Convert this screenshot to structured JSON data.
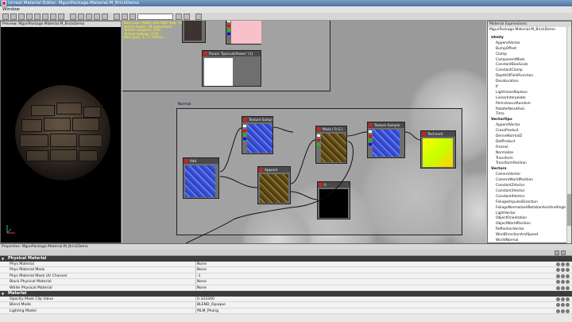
{
  "window": {
    "title": "Unreal Material Editor: MgunPackage.Material.M_BrickDemo"
  },
  "menubar": {
    "items": [
      "Window"
    ]
  },
  "toolbar": {
    "search_placeholder": ""
  },
  "preview": {
    "title": "Preview: MgunPackage.Material.M_BrickDemo"
  },
  "canvas": {
    "info_lines": [
      "Base pass shader with light map: 73 instructions",
      "Vertex shader: 28 instructions",
      "Texture samplers: 2/16",
      "Texture lookups: 2/16",
      "Base pass: 1 / 11 instruc..."
    ],
    "group_label": "Normal",
    "nodes": {
      "specular_power": "Param 'SpecularPower' (1)",
      "texture_sample_1": "Texture Sample",
      "mask": "Mask ( R G )",
      "texture_sample_2": "Texture Sample",
      "tex_coord": "TexCoord",
      "add": "Add",
      "append": "Append",
      "constant": "0"
    }
  },
  "expressions": {
    "title": "Material Expressions: MgunPackage.Material.M_BrickDemo",
    "items": [
      {
        "type": "cat",
        "label": "Utility"
      },
      {
        "type": "item",
        "label": "AppendVector"
      },
      {
        "type": "item",
        "label": "BumpOffset"
      },
      {
        "type": "item",
        "label": "Clamp"
      },
      {
        "type": "item",
        "label": "ComponentMask"
      },
      {
        "type": "item",
        "label": "ConstantBiasScale"
      },
      {
        "type": "item",
        "label": "ConstantClamp"
      },
      {
        "type": "item",
        "label": "DepthOfFieldFunction"
      },
      {
        "type": "item",
        "label": "Desaturation"
      },
      {
        "type": "item",
        "label": "If"
      },
      {
        "type": "item",
        "label": "LightmassReplace"
      },
      {
        "type": "item",
        "label": "LinearInterpolate"
      },
      {
        "type": "item",
        "label": "PerInstanceRandom"
      },
      {
        "type": "item",
        "label": "RotateAboutAxis"
      },
      {
        "type": "item",
        "label": "Time"
      },
      {
        "type": "cat",
        "label": "VectorOps"
      },
      {
        "type": "item",
        "label": "AppendVector"
      },
      {
        "type": "item",
        "label": "CrossProduct"
      },
      {
        "type": "item",
        "label": "DeriveNormalZ"
      },
      {
        "type": "item",
        "label": "DotProduct"
      },
      {
        "type": "item",
        "label": "Fresnel"
      },
      {
        "type": "item",
        "label": "Normalize"
      },
      {
        "type": "item",
        "label": "Transform"
      },
      {
        "type": "item",
        "label": "TransformPosition"
      },
      {
        "type": "cat",
        "label": "Vectors"
      },
      {
        "type": "item",
        "label": "CameraVector"
      },
      {
        "type": "item",
        "label": "CameraWorldPosition"
      },
      {
        "type": "item",
        "label": "Constant2Vector"
      },
      {
        "type": "item",
        "label": "Constant3Vector"
      },
      {
        "type": "item",
        "label": "Constant4Vector"
      },
      {
        "type": "item",
        "label": "FoliageImpulseDirection"
      },
      {
        "type": "item",
        "label": "FoliageNormalizedRotationAxisAndAngle"
      },
      {
        "type": "item",
        "label": "LightVector"
      },
      {
        "type": "item",
        "label": "ObjectOrientation"
      },
      {
        "type": "item",
        "label": "ObjectWorldPosition"
      },
      {
        "type": "item",
        "label": "ReflectionVector"
      },
      {
        "type": "item",
        "label": "WindDirectionAndSpeed"
      },
      {
        "type": "item",
        "label": "WorldNormal"
      }
    ]
  },
  "properties": {
    "title": "Properties: MgunPackage.Material.M_BrickDemo",
    "sections": [
      {
        "name": "Physical Material",
        "rows": [
          {
            "label": "Phys Material",
            "value": "None"
          },
          {
            "label": "Phys Material Mask",
            "value": "None"
          },
          {
            "label": "Phys Material Mask UV Channel",
            "value": "-1"
          },
          {
            "label": "Black Physical Material",
            "value": "None"
          },
          {
            "label": "White Physical Material",
            "value": "None"
          }
        ]
      },
      {
        "name": "Material",
        "rows": [
          {
            "label": "Opacity Mask Clip Value",
            "value": "0.333300"
          },
          {
            "label": "Blend Mode",
            "value": "BLEND_Opaque"
          },
          {
            "label": "Lighting Model",
            "value": "MLM_Phong"
          }
        ]
      }
    ]
  }
}
